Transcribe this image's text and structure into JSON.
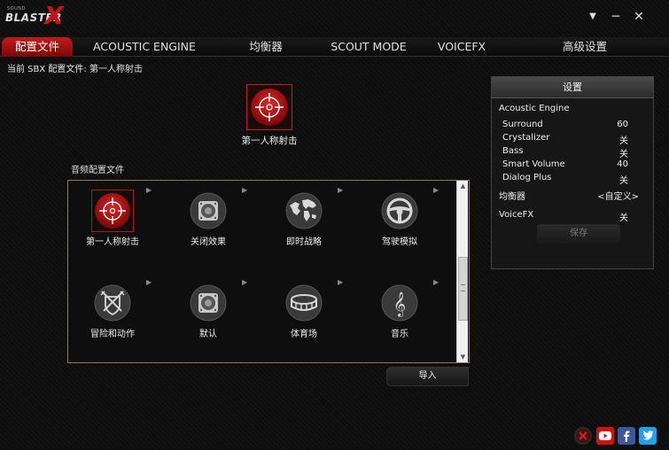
{
  "app": {
    "logo_small": "SOUND",
    "logo_main": "BLASTER",
    "logo_x": "X"
  },
  "window": {
    "minimize_glyph": "▼",
    "collapse_glyph": "─",
    "close_glyph": "✕"
  },
  "tabs": [
    {
      "label": "配置文件",
      "active": true
    },
    {
      "label": "ACOUSTIC ENGINE"
    },
    {
      "label": "均衡器"
    },
    {
      "label": "SCOUT MODE"
    },
    {
      "label": "VOICEFX"
    },
    {
      "label": "高级设置"
    }
  ],
  "current_profile": {
    "text": "当前 SBX 配置文件: 第一人称射击",
    "icon": "crosshair-icon",
    "label": "第一人称射击"
  },
  "profiles_section": {
    "title": "音频配置文件",
    "items": [
      {
        "label": "第一人称射击",
        "icon": "crosshair-icon",
        "selected": true
      },
      {
        "label": "关闭效果",
        "icon": "speaker-icon"
      },
      {
        "label": "即时战略",
        "icon": "world-map-icon"
      },
      {
        "label": "驾驶模拟",
        "icon": "steering-wheel-icon"
      },
      {
        "label": "冒险和动作",
        "icon": "crossed-swords-shield-icon"
      },
      {
        "label": "默认",
        "icon": "speaker-icon"
      },
      {
        "label": "体育场",
        "icon": "stadium-icon"
      },
      {
        "label": "音乐",
        "icon": "treble-clef-icon"
      }
    ],
    "scroll_up": "▲",
    "scroll_down": "▼",
    "import_label": "导入"
  },
  "settings": {
    "title": "设置",
    "section": "Acoustic Engine",
    "rows": [
      {
        "key": "Surround",
        "value": "60"
      },
      {
        "key": "Crystalizer",
        "value": "关"
      },
      {
        "key": "Bass",
        "value": "关"
      },
      {
        "key": "Smart Volume",
        "value": "40"
      },
      {
        "key": "Dialog Plus",
        "value": "关"
      }
    ],
    "equalizer": {
      "key": "均衡器",
      "value": "<自定义>"
    },
    "voicefx": {
      "key": "VoiceFX",
      "value": "关"
    },
    "save_label": "保存"
  },
  "social": [
    {
      "icon": "close-circle-icon",
      "color": "#b01515"
    },
    {
      "icon": "youtube-icon",
      "color": "#d01010"
    },
    {
      "icon": "facebook-icon",
      "color": "#3b5998"
    },
    {
      "icon": "twitter-icon",
      "color": "#1da1f2"
    }
  ],
  "accent_color": "#c41b1b"
}
